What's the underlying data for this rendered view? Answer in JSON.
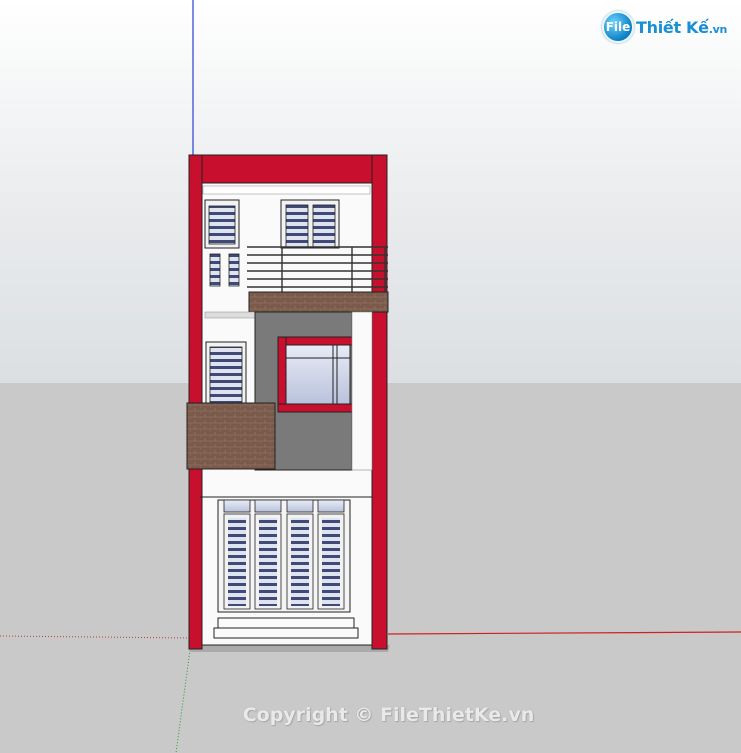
{
  "watermark": {
    "logo_mark": "File",
    "logo_name": "Thiết Kế",
    "logo_domain": ".vn",
    "copyright": "Copyright © FileThietKe.vn"
  },
  "scene": {
    "subject": "3D model of a narrow three-storey townhouse facade",
    "colors": {
      "frame_red": "#c8102e",
      "wall_white": "#fafafa",
      "accent_gray": "#7a7a7a",
      "brick": "#7a5a4a",
      "glass_blue": "#3f4a78",
      "sky": "#e3e6e9",
      "ground": "#c9c9c9"
    }
  }
}
